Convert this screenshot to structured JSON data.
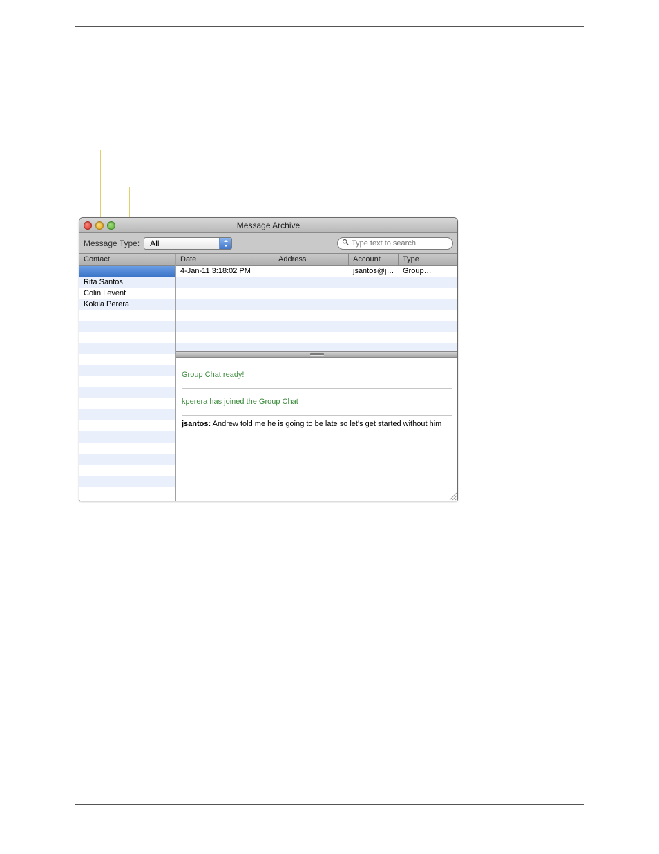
{
  "window_title": "Message Archive",
  "toolbar": {
    "message_type_label": "Message Type:",
    "message_type_value": "All",
    "search_placeholder": "Type text to search"
  },
  "contacts": {
    "header": "Contact",
    "items": [
      "Rita Santos",
      "Colin Levent",
      "Kokila Perera"
    ]
  },
  "table": {
    "columns": [
      "Date",
      "Address",
      "Account",
      "Type"
    ],
    "rows": [
      {
        "date": "4-Jan-11 3:18:02 PM",
        "address": "",
        "account": "jsantos@j…",
        "type": "Group…"
      }
    ]
  },
  "transcript": {
    "status1": "Group Chat ready!",
    "status2": "kperera has joined the Group Chat",
    "msg_user": "jsantos:",
    "msg_text": " Andrew told me he is going to be late so let's get started without him"
  }
}
